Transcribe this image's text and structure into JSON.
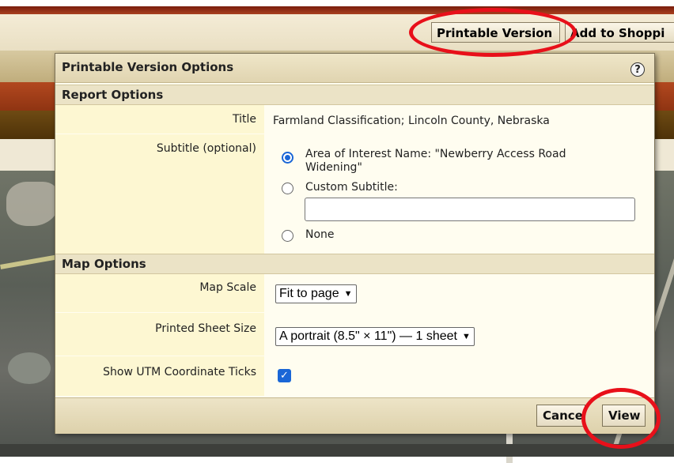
{
  "toolbar": {
    "printable_label": "Printable Version",
    "add_to_shopping_label": "Add to Shoppi"
  },
  "dialog": {
    "title": "Printable Version Options",
    "help_symbol": "?",
    "report_options": {
      "heading": "Report Options",
      "title_label": "Title",
      "title_value": "Farmland Classification; Lincoln County, Nebraska",
      "subtitle_label": "Subtitle (optional)",
      "subtitle_choices": [
        {
          "label": "Area of Interest Name: \"Newberry Access Road Widening\"",
          "checked": true
        },
        {
          "label": "Custom Subtitle:",
          "checked": false
        },
        {
          "label": "None",
          "checked": false
        }
      ],
      "custom_subtitle_value": ""
    },
    "map_options": {
      "heading": "Map Options",
      "map_scale_label": "Map Scale",
      "map_scale_value": "Fit to page",
      "sheet_size_label": "Printed Sheet Size",
      "sheet_size_value": "A portrait (8.5\" × 11\") — 1 sheet",
      "utm_label": "Show UTM Coordinate Ticks",
      "utm_checked": true
    },
    "footer": {
      "cancel_label": "Cance",
      "view_label": "View"
    }
  },
  "colors": {
    "annotation": "#e8101a",
    "accent": "#1a66d6"
  }
}
